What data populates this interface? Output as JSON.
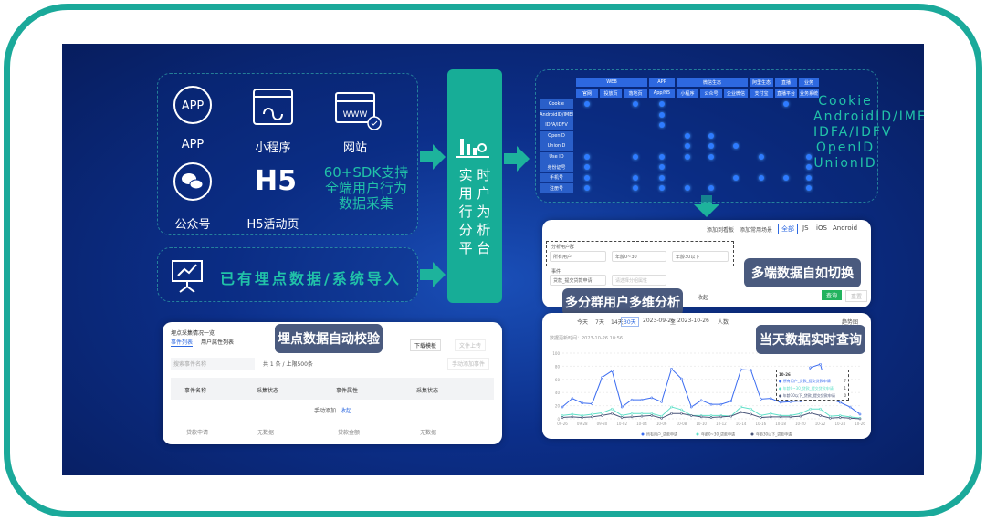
{
  "sources": {
    "items": [
      {
        "label": "APP",
        "icon": "app-icon"
      },
      {
        "label": "小程序",
        "icon": "miniprogram-icon"
      },
      {
        "label": "网站",
        "icon": "website-icon"
      },
      {
        "label": "公众号",
        "icon": "wechat-icon"
      },
      {
        "label": "H5活动页",
        "icon": "h5-icon"
      }
    ],
    "sdk_text": [
      "60+SDK支持",
      "全端用户行为",
      "数据采集"
    ]
  },
  "import": {
    "label": "已有埋点数据/系统导入",
    "icon": "presentation-chart-icon"
  },
  "platform": {
    "rows": [
      "实 时",
      "用 户",
      "行 为",
      "分 析",
      "平 台"
    ],
    "icon": "bar-chart-search-icon"
  },
  "oneid": {
    "rows": [
      "Cookie",
      "AndroidID/IMEI",
      "IDFA/IDFV",
      "OpenID",
      "UnionID",
      "Use ID",
      "身份证号",
      "手机号",
      "注册号"
    ],
    "headers": [
      "WEB",
      "APP",
      "微信生态",
      "阿里生态",
      "直播",
      "业务"
    ],
    "subheaders": [
      "官网",
      "投放页",
      "落地页",
      "App/H5",
      "小程序",
      "公众号",
      "企业微信",
      "支付宝",
      "直播平台",
      "业务系统"
    ]
  },
  "tags": {
    "multi_platform": "多端数据自如切换",
    "multi_group": "多分群用户多维分析",
    "realtime": "当天数据实时查询",
    "auto_check": "埋点数据自动校验"
  },
  "analysis_card": {
    "buttons": [
      "添加到看板",
      "添加常用场景"
    ],
    "platform_tabs": [
      "全部",
      "JS",
      "iOS",
      "Android"
    ],
    "group_label": "分析用户群",
    "groups": [
      "所有用户",
      "年龄0~30",
      "年龄30以下"
    ],
    "event_label": "事件",
    "event": "贷款_提交贷款申请",
    "attr_placeholder": "请选择分组属性",
    "query": "查询",
    "reset": "重置",
    "collapse": "收起"
  },
  "chart_card": {
    "ranges": [
      "今天",
      "7天",
      "14天",
      "30天"
    ],
    "active_range": "30天",
    "date_from": "2023-09-26",
    "to": "至",
    "date_to": "2023-10-26",
    "metric": "人数",
    "trend": "趋势图",
    "updated": "数据更新时间：2023-10-26 10:56",
    "tooltip": {
      "title": "10-26",
      "items": [
        {
          "name": "所有用户_贷款_提交贷款申请",
          "value": "7"
        },
        {
          "name": "年龄0~30_贷款_提交贷款申请",
          "value": "1"
        },
        {
          "name": "年龄30以下_贷款_提交贷款申请",
          "value": "0"
        }
      ]
    }
  },
  "chart_data": {
    "type": "line",
    "ylim": [
      0,
      100
    ],
    "yticks": [
      0,
      20,
      40,
      60,
      80,
      100
    ],
    "x": [
      "09-26",
      "09-27",
      "09-28",
      "09-29",
      "09-30",
      "10-01",
      "10-02",
      "10-03",
      "10-04",
      "10-05",
      "10-06",
      "10-07",
      "10-08",
      "10-09",
      "10-10",
      "10-11",
      "10-12",
      "10-13",
      "10-14",
      "10-15",
      "10-16",
      "10-17",
      "10-18",
      "10-19",
      "10-20",
      "10-21",
      "10-22",
      "10-23",
      "10-24",
      "10-25",
      "10-26"
    ],
    "xticks": [
      "09-26",
      "09-28",
      "09-30",
      "10-02",
      "10-04",
      "10-06",
      "10-08",
      "10-10",
      "10-12",
      "10-14",
      "10-16",
      "10-18",
      "10-20",
      "10-22",
      "10-24",
      "10-26"
    ],
    "series": [
      {
        "name": "所有用户_贷款申请",
        "color": "#3b6cf0",
        "values": [
          18,
          31,
          24,
          23,
          63,
          73,
          18,
          29,
          29,
          32,
          26,
          76,
          61,
          18,
          28,
          22,
          22,
          27,
          75,
          74,
          30,
          31,
          25,
          26,
          27,
          78,
          83,
          30,
          25,
          18,
          7
        ]
      },
      {
        "name": "年龄0~30_贷款申请",
        "color": "#5fe0c8",
        "values": [
          5,
          7,
          5,
          7,
          9,
          15,
          5,
          8,
          8,
          8,
          4,
          18,
          14,
          5,
          5,
          5,
          5,
          4,
          18,
          15,
          5,
          8,
          5,
          5,
          8,
          15,
          15,
          4,
          5,
          3,
          1
        ]
      },
      {
        "name": "年龄30以下_贷款申请",
        "color": "#4a5578",
        "values": [
          2,
          3,
          2,
          3,
          5,
          8,
          2,
          3,
          4,
          5,
          1,
          8,
          8,
          5,
          3,
          2,
          3,
          4,
          10,
          7,
          2,
          3,
          3,
          3,
          4,
          9,
          5,
          1,
          2,
          1,
          0
        ]
      }
    ]
  },
  "event_card": {
    "title": "埋点采集情况一览",
    "tabs": [
      "事件列表",
      "用户属性列表"
    ],
    "download": "下载模板",
    "upload": "文件上传",
    "search_placeholder": "搜索事件名称",
    "count": "共 1 条 / 上限500条",
    "add_event": "手动添加事件",
    "columns": [
      "事件名称",
      "采集状态",
      "事件属性",
      "采集状态"
    ],
    "manual": "手动添加",
    "fold": "收起",
    "row": [
      "贷款申请",
      "无数据",
      "贷款金额",
      "无数据"
    ]
  }
}
